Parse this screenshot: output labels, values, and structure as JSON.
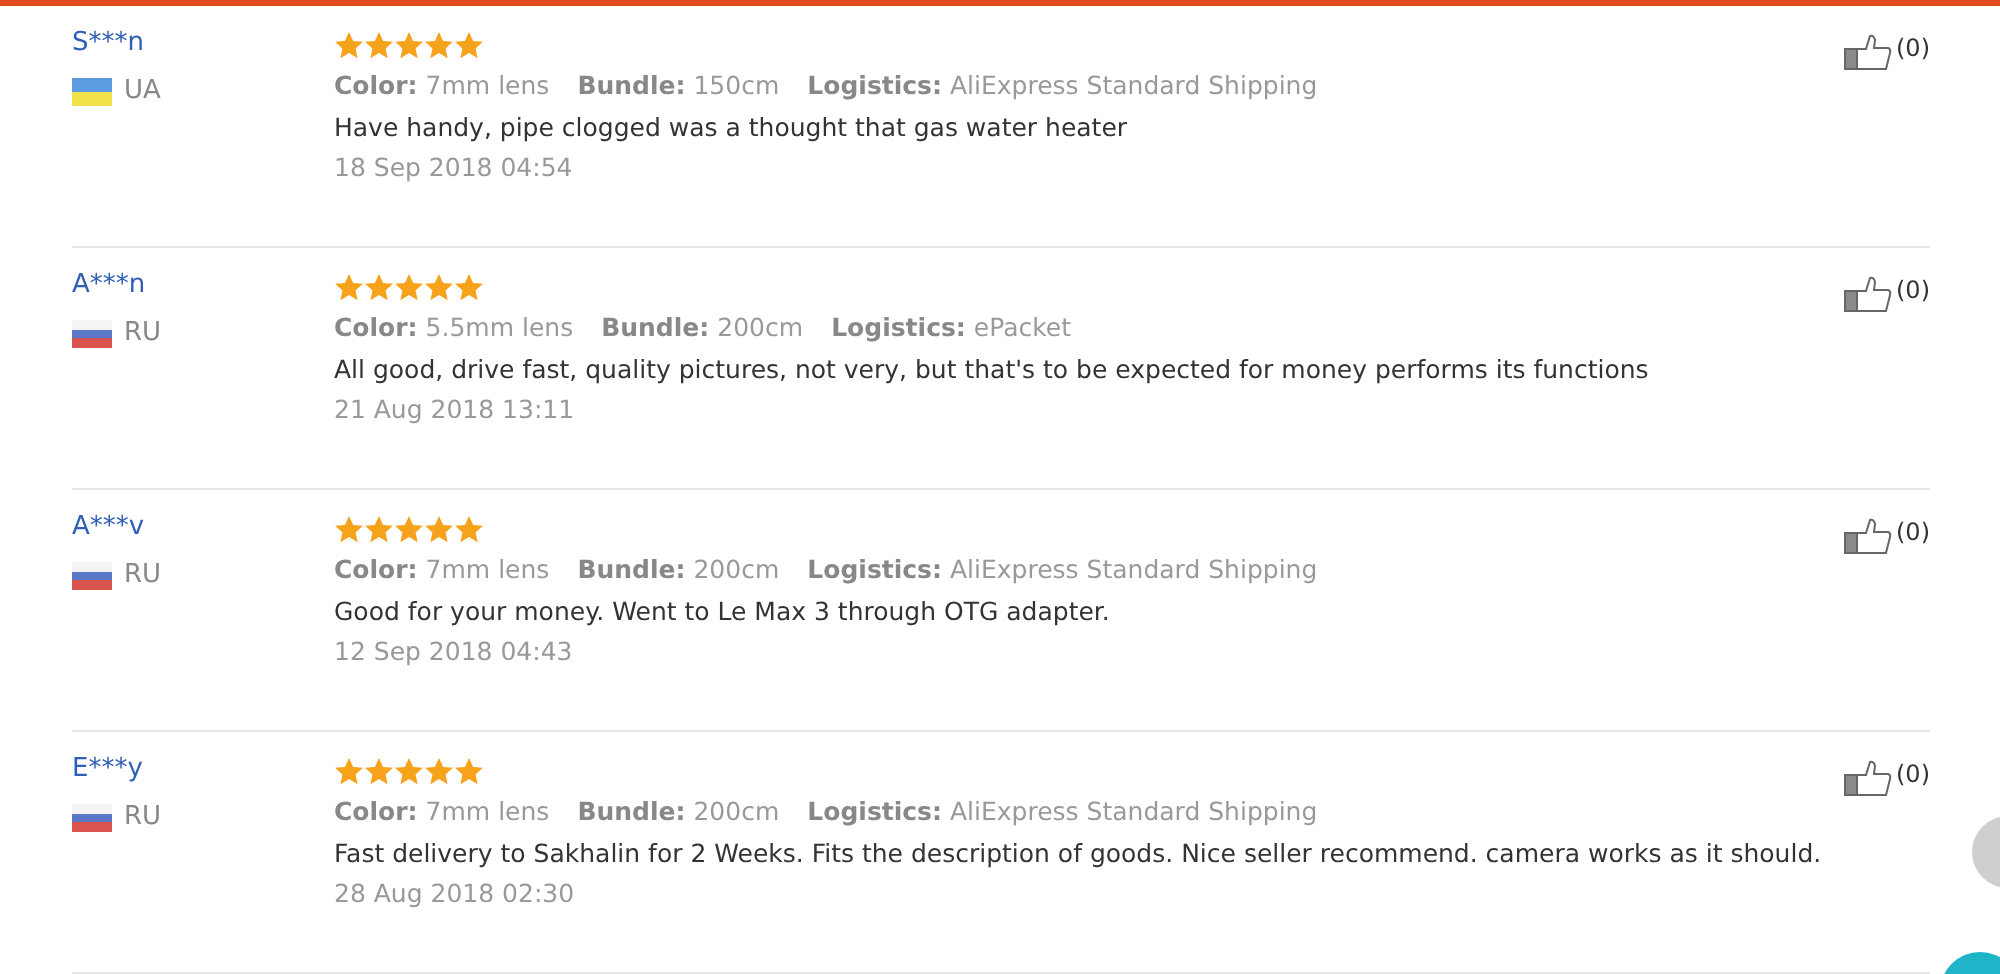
{
  "reviews": [
    {
      "name": "S***n",
      "country": {
        "kind": "ua",
        "code": "UA"
      },
      "stars": 5,
      "specs": [
        {
          "label": "Color:",
          "value": "7mm lens"
        },
        {
          "label": "Bundle:",
          "value": "150cm"
        },
        {
          "label": "Logistics:",
          "value": "AliExpress Standard Shipping"
        }
      ],
      "text": "Have handy, pipe clogged was a thought that gas water heater",
      "date": "18 Sep 2018 04:54",
      "likes": "(0)"
    },
    {
      "name": "A***n",
      "country": {
        "kind": "ru",
        "code": "RU"
      },
      "stars": 5,
      "specs": [
        {
          "label": "Color:",
          "value": "5.5mm lens"
        },
        {
          "label": "Bundle:",
          "value": "200cm"
        },
        {
          "label": "Logistics:",
          "value": "ePacket"
        }
      ],
      "text": "All good, drive fast, quality pictures, not very, but that's to be expected for money performs its functions",
      "date": "21 Aug 2018 13:11",
      "likes": "(0)"
    },
    {
      "name": "A***v",
      "country": {
        "kind": "ru",
        "code": "RU"
      },
      "stars": 5,
      "specs": [
        {
          "label": "Color:",
          "value": "7mm lens"
        },
        {
          "label": "Bundle:",
          "value": "200cm"
        },
        {
          "label": "Logistics:",
          "value": "AliExpress Standard Shipping"
        }
      ],
      "text": "Good for your money. Went to Le Max 3 through OTG adapter.",
      "date": "12 Sep 2018 04:43",
      "likes": "(0)"
    },
    {
      "name": "E***y",
      "country": {
        "kind": "ru",
        "code": "RU"
      },
      "stars": 5,
      "specs": [
        {
          "label": "Color:",
          "value": "7mm lens"
        },
        {
          "label": "Bundle:",
          "value": "200cm"
        },
        {
          "label": "Logistics:",
          "value": "AliExpress Standard Shipping"
        }
      ],
      "text": "Fast delivery to Sakhalin for 2 Weeks. Fits the description of goods. Nice seller recommend. camera works as it should.",
      "date": "28 Aug 2018 02:30",
      "likes": "(0)"
    }
  ]
}
